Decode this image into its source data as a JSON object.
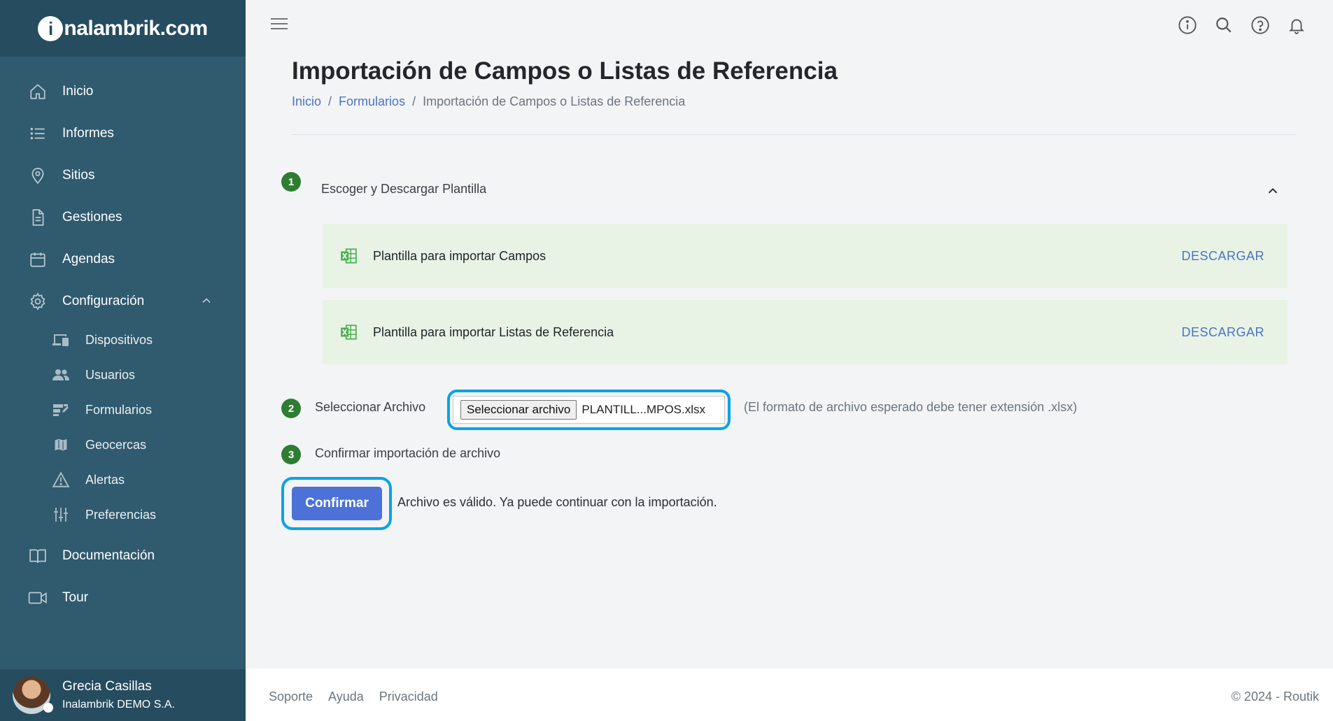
{
  "brand": {
    "logo_text": "inalambrik.com",
    "logo_initial": "i",
    "logo_rest": "nalambrik.com"
  },
  "sidebar": {
    "items": [
      {
        "label": "Inicio",
        "icon": "home-icon"
      },
      {
        "label": "Informes",
        "icon": "list-icon"
      },
      {
        "label": "Sitios",
        "icon": "map-pin-icon"
      },
      {
        "label": "Gestiones",
        "icon": "document-icon"
      },
      {
        "label": "Agendas",
        "icon": "calendar-icon"
      },
      {
        "label": "Configuración",
        "icon": "gear-icon",
        "expanded": true
      }
    ],
    "subitems": [
      {
        "label": "Dispositivos",
        "icon": "devices-icon"
      },
      {
        "label": "Usuarios",
        "icon": "users-icon"
      },
      {
        "label": "Formularios",
        "icon": "forms-icon"
      },
      {
        "label": "Geocercas",
        "icon": "map-icon"
      },
      {
        "label": "Alertas",
        "icon": "warning-icon"
      },
      {
        "label": "Preferencias",
        "icon": "sliders-icon"
      }
    ],
    "bottom_items": [
      {
        "label": "Documentación",
        "icon": "book-icon"
      },
      {
        "label": "Tour",
        "icon": "video-icon"
      }
    ]
  },
  "user": {
    "name": "Grecia Casillas",
    "org": "Inalambrik DEMO S.A."
  },
  "topbar": {
    "icons": [
      "info-icon",
      "search-icon",
      "help-icon",
      "bell-icon"
    ]
  },
  "page": {
    "title": "Importación de Campos o Listas de Referencia",
    "breadcrumb": {
      "home": "Inicio",
      "section": "Formularios",
      "current": "Importación de Campos o Listas de Referencia",
      "separator": "/"
    }
  },
  "steps": {
    "step1": {
      "number": "1",
      "label": "Escoger y Descargar Plantilla"
    },
    "templates": [
      {
        "name": "Plantilla para importar Campos",
        "action": "DESCARGAR"
      },
      {
        "name": "Plantilla para importar Listas de Referencia",
        "action": "DESCARGAR"
      }
    ],
    "step2": {
      "number": "2",
      "label": "Seleccionar Archivo",
      "button": "Seleccionar archivo",
      "file_name": "PLANTILL...MPOS.xlsx",
      "hint": "(El formato de archivo esperado debe tener extensión .xlsx)"
    },
    "step3": {
      "number": "3",
      "label": "Confirmar importación de archivo"
    },
    "confirm": {
      "button": "Confirmar",
      "message": "Archivo es válido. Ya puede continuar con la importación."
    }
  },
  "footer": {
    "links": [
      "Soporte",
      "Ayuda",
      "Privacidad"
    ],
    "copyright": "© 2024 - Routik"
  },
  "colors": {
    "sidebar": "#305a6e",
    "sidebar_dark": "#264c5f",
    "accent": "#4c72d8",
    "highlight": "#0aa2e8",
    "step": "#2e7d32",
    "template_bg": "#e8f3e5"
  }
}
